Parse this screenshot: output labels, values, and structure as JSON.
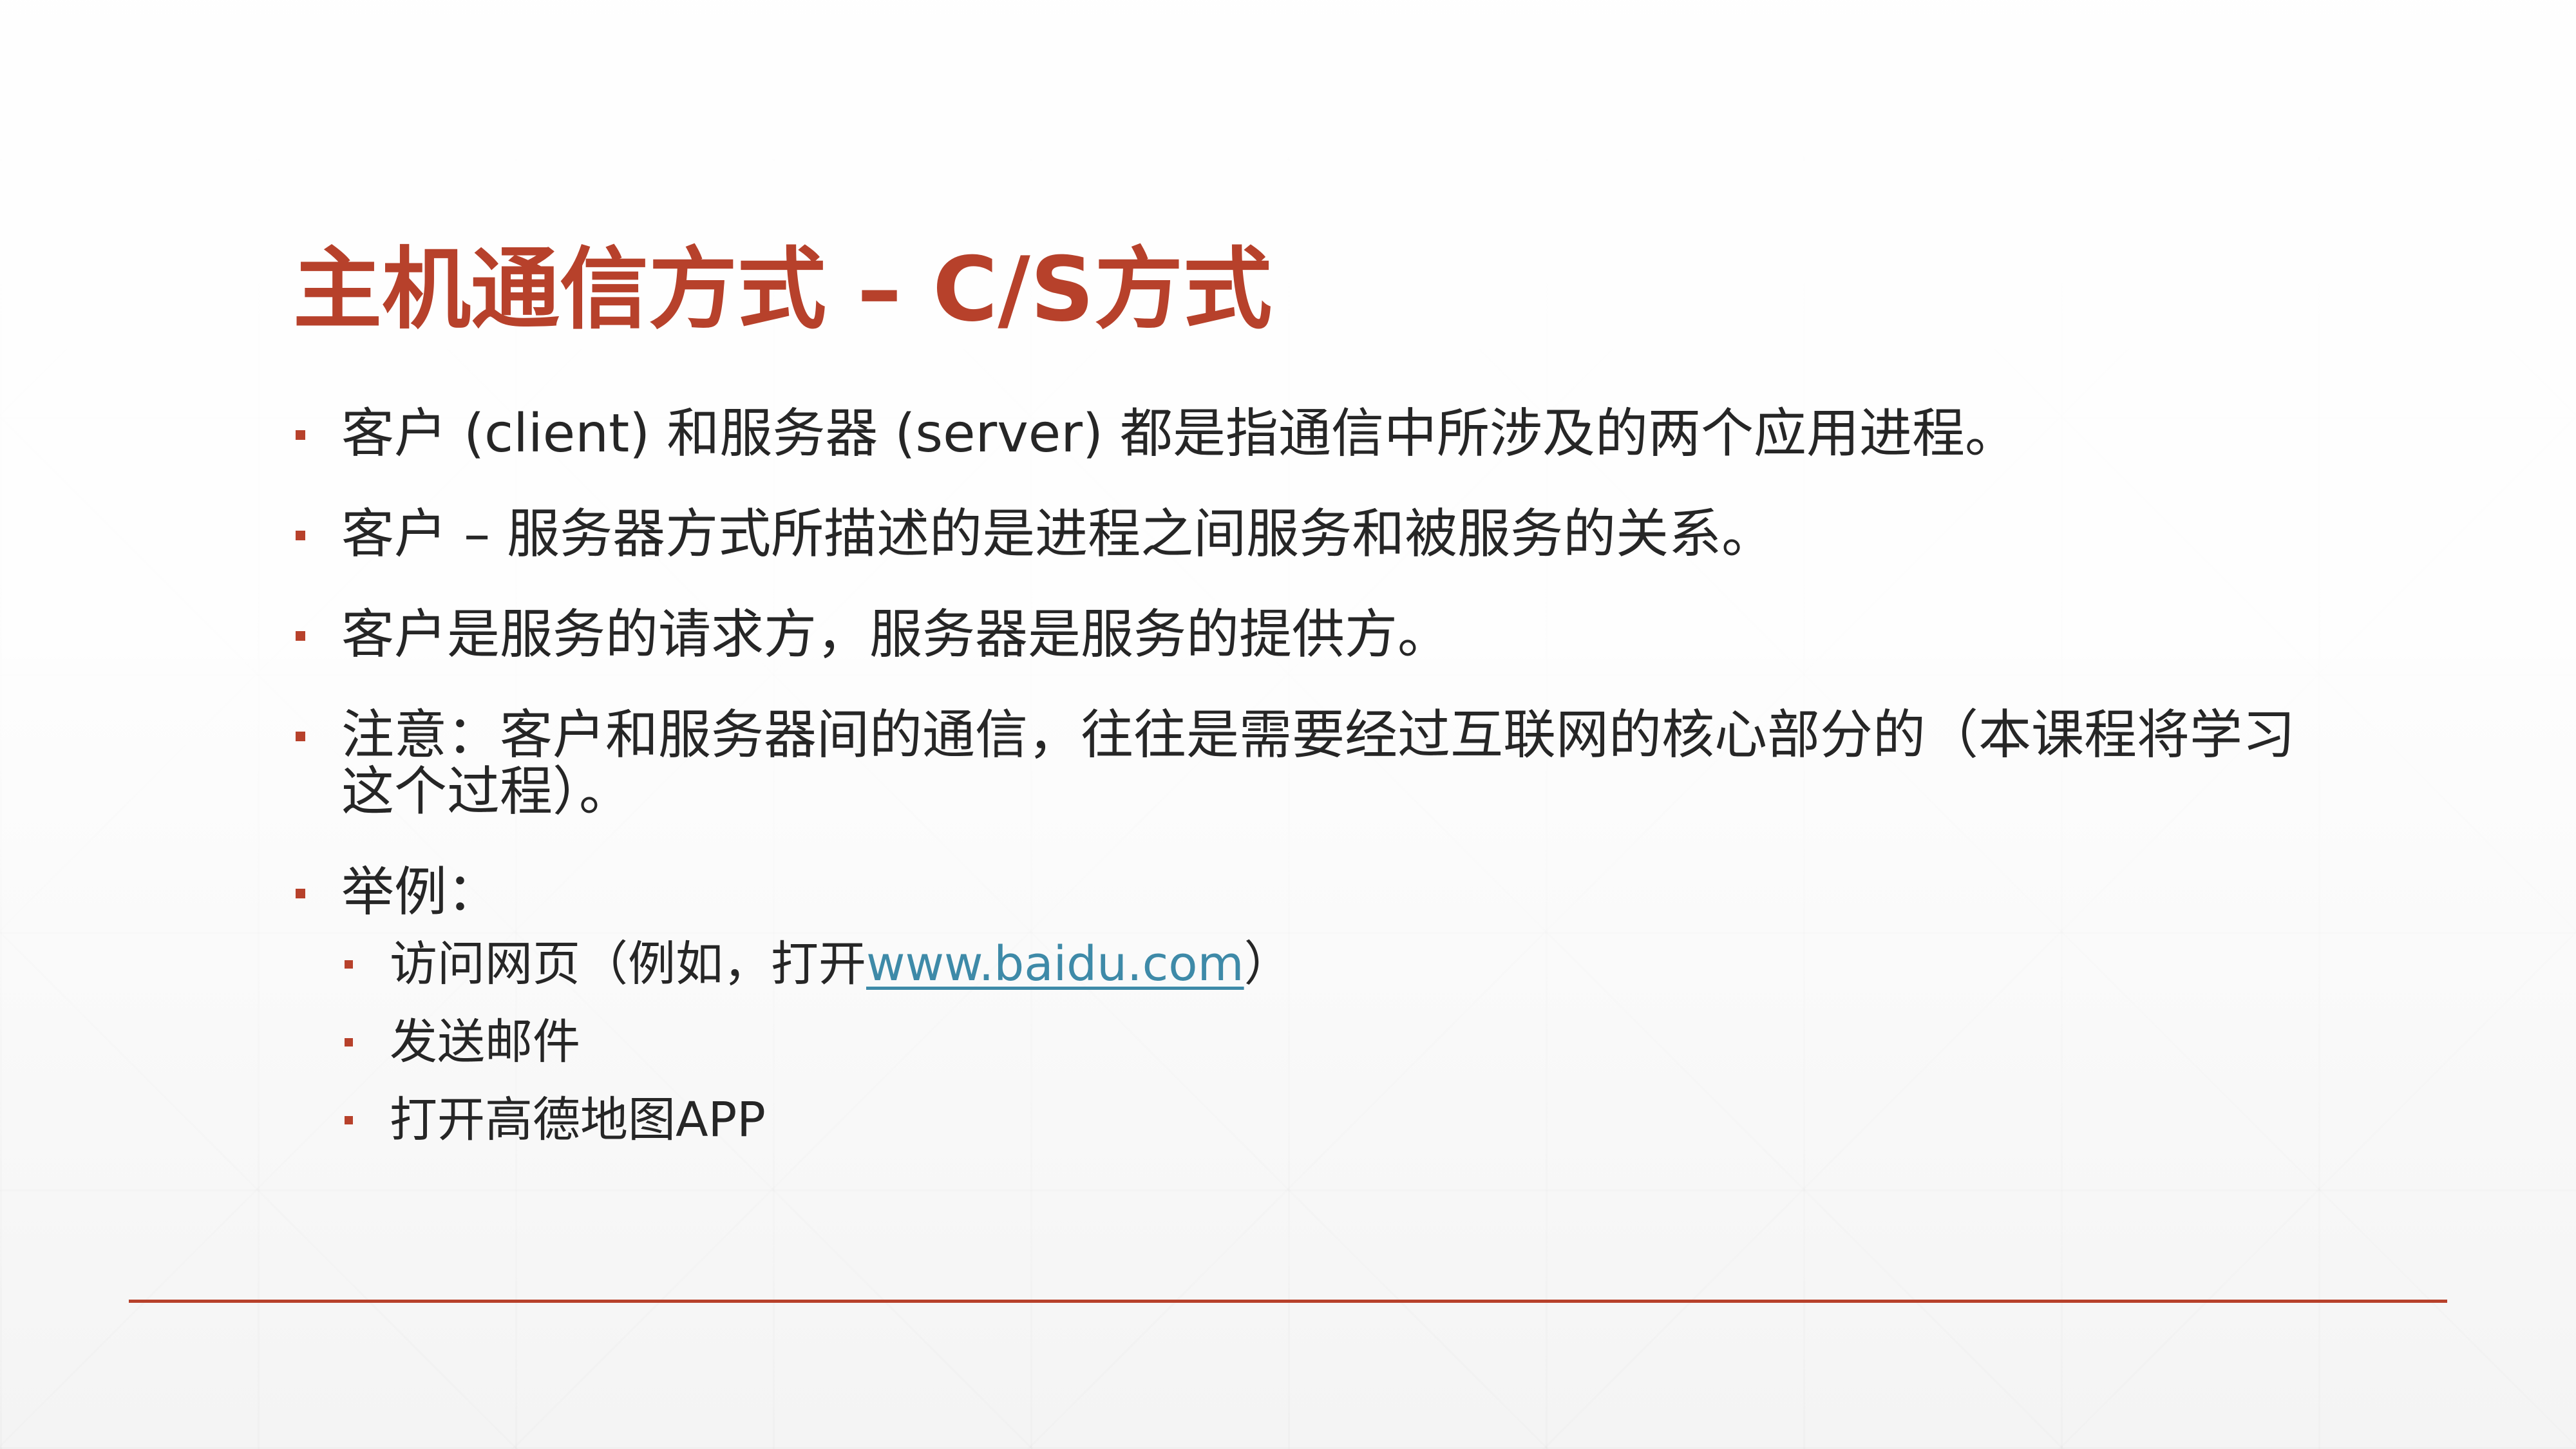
{
  "slide": {
    "title": "主机通信方式 – C/S方式",
    "accent_color": "#b7412b",
    "link_color": "#3e8aa8",
    "text_color": "#262626",
    "bullets": [
      "客户 (client) 和服务器 (server) 都是指通信中所涉及的两个应用进程。",
      "客户 – 服务器方式所描述的是进程之间服务和被服务的关系。",
      "客户是服务的请求方，服务器是服务的提供方。",
      "注意：客户和服务器间的通信，往往是需要经过互联网的核心部分的（本课程将学习这个过程）。",
      "举例："
    ],
    "examples": [
      {
        "prefix": "访问网页（例如，打开",
        "link": "www.baidu.com",
        "suffix": "）"
      },
      {
        "text": "发送邮件"
      },
      {
        "text": "打开高德地图APP"
      }
    ]
  }
}
